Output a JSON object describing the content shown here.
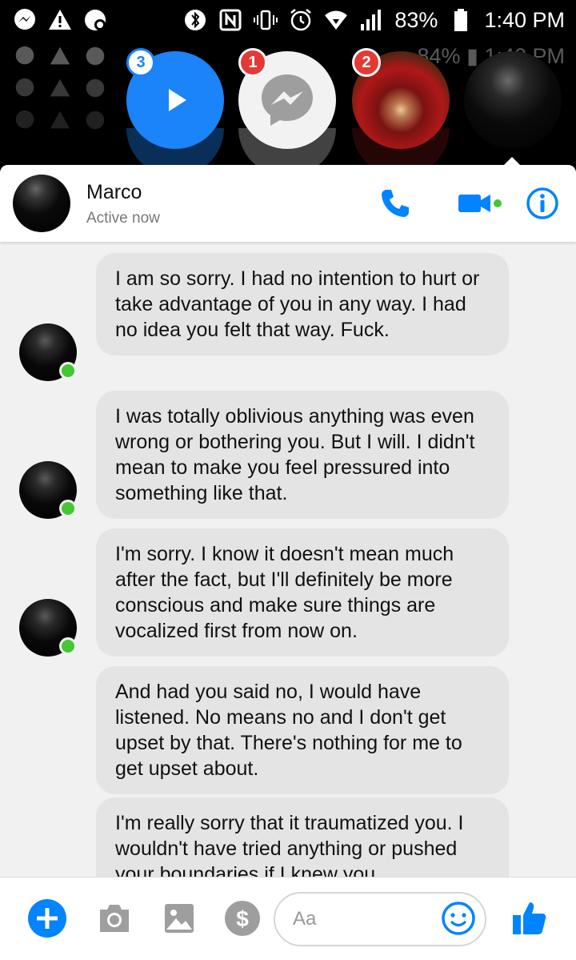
{
  "status_bar": {
    "battery_percent": "83%",
    "time": "1:40 PM"
  },
  "ghost_status": {
    "battery_percent": "84%",
    "time": "1:40 PM"
  },
  "chat_heads": [
    {
      "kind": "play",
      "badge": "3",
      "color": "#1a84f8"
    },
    {
      "kind": "messenger",
      "badge": "1",
      "color": "#f2f2f2"
    },
    {
      "kind": "photo-contact",
      "badge": "2",
      "color": "#8a1a1a"
    },
    {
      "kind": "marco",
      "badge": "",
      "color": "#111111"
    }
  ],
  "conversation": {
    "contact_name": "Marco",
    "contact_status": "Active now"
  },
  "messages": [
    {
      "text": "I am so sorry. I had no intention to hurt or take advantage of you in any way.    I had no idea you felt that way. Fuck.",
      "avatar": true
    },
    {
      "text": "I was totally oblivious anything was even wrong or bothering you. But I will. I didn't mean to make you feel pressured into something like that.",
      "avatar": true
    },
    {
      "text": "I'm sorry. I know it doesn't mean much after the fact, but I'll definitely be more conscious and make sure things are vocalized first from now on.",
      "avatar": true
    },
    {
      "text": "And had you said no, I would have listened. No means no and I don't get upset by that.  There's nothing for me to get upset about.",
      "avatar": false
    },
    {
      "text": "I'm really sorry that it traumatized you. I wouldn't have tried anything or pushed your boundaries if I knew you",
      "avatar": false
    }
  ],
  "composer": {
    "placeholder": "Aa"
  },
  "colors": {
    "accent": "#0084ff",
    "online": "#42c832",
    "bubble": "#e4e4e4",
    "badge_red": "#e53935"
  }
}
